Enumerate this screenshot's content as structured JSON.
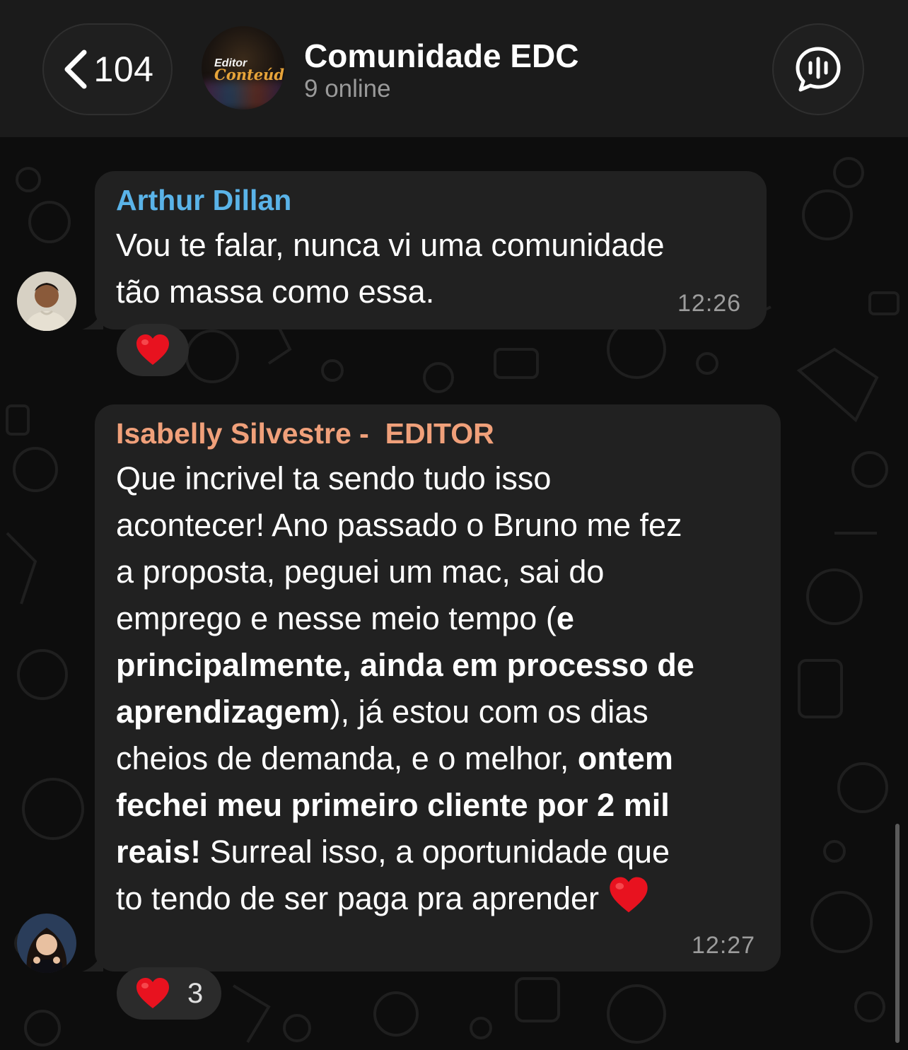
{
  "header": {
    "back_count": "104",
    "title": "Comunidade EDC",
    "subtitle": "9 online",
    "avatar_logo_top": "Editor",
    "avatar_logo_bottom": "Conteúdo"
  },
  "messages": [
    {
      "sender": "Arthur Dillan",
      "sender_color": "#5ab3e8",
      "text": "Vou te falar, nunca vi uma comunidade\ntão massa como essa.",
      "time": "12:26",
      "reaction": {
        "emoji": "heart",
        "count": ""
      }
    },
    {
      "sender": "Isabelly Silvestre -  EDITOR",
      "sender_color": "#f0a07a",
      "text_parts": [
        "Que incrivel ta sendo tudo isso\nacontecer! Ano passado o Bruno me fez\na proposta, peguei um mac, sai do\nemprego e nesse meio tempo (",
        "e\nprincipalmente, ainda em processo de\naprendizagem",
        "), já estou com os dias\ncheios de demanda, e o melhor, ",
        "ontem\nfechei meu primeiro cliente por 2 mil\nreais!",
        " Surreal isso, a oportunidade que\nto tendo de ser paga pra aprender "
      ],
      "time": "12:27",
      "reaction": {
        "emoji": "heart",
        "count": "3"
      }
    }
  ],
  "colors": {
    "header_bg": "#1b1b1b",
    "chat_bg": "#0d0d0d",
    "bubble_bg": "#212121",
    "heart": "#e8121f"
  }
}
